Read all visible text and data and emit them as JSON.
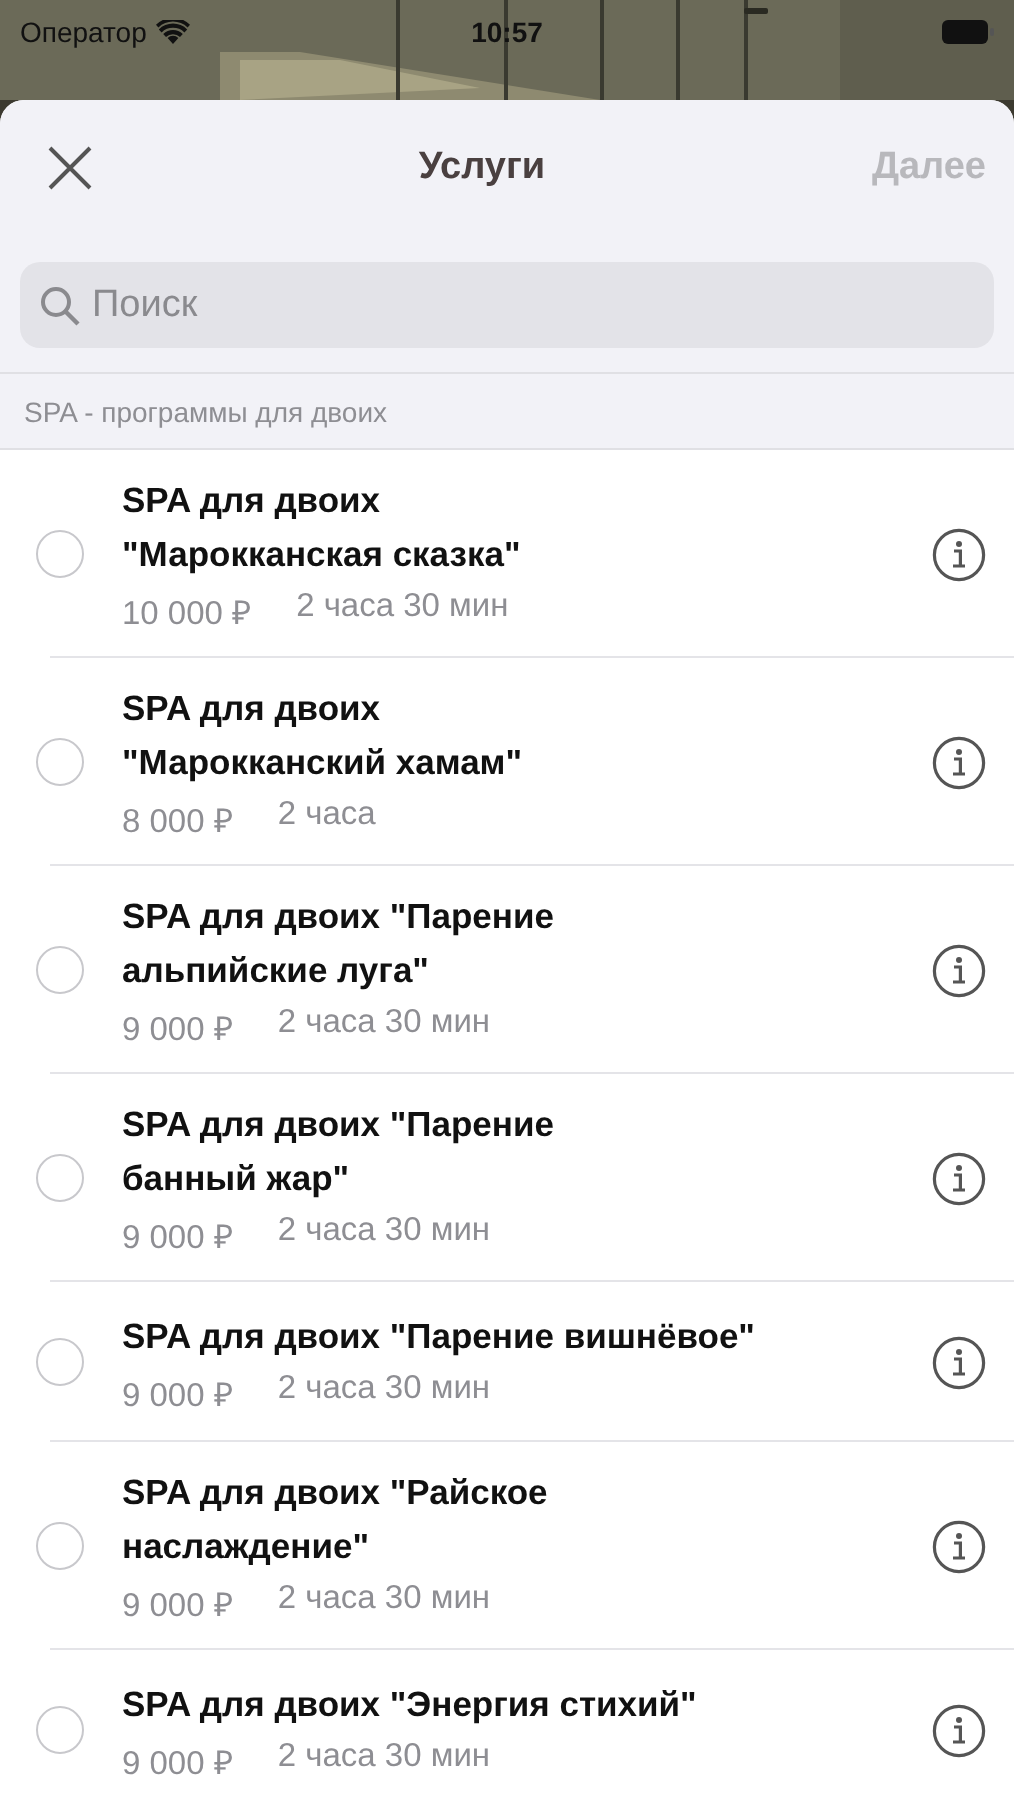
{
  "status_bar": {
    "carrier": "Оператор",
    "time": "10:57"
  },
  "nav": {
    "title": "Услуги",
    "next": {
      "label": "Далее",
      "disabled": true
    }
  },
  "search": {
    "placeholder": "Поиск"
  },
  "section": {
    "title": "SPA - программы для двоих"
  },
  "services": [
    {
      "title": "SPA для двоих\n\"Марокканская сказка\"",
      "price": "10 000 ₽",
      "duration": "2 часа 30 мин",
      "selected": false
    },
    {
      "title": "SPA для двоих\n\"Марокканский хамам\"",
      "price": "8 000 ₽",
      "duration": "2 часа",
      "selected": false
    },
    {
      "title": "SPA для двоих \"Парение\nальпийские луга\"",
      "price": "9 000 ₽",
      "duration": "2 часа 30 мин",
      "selected": false
    },
    {
      "title": "SPA для двоих \"Парение\nбанный жар\"",
      "price": "9 000 ₽",
      "duration": "2 часа 30 мин",
      "selected": false
    },
    {
      "title": "SPA для двоих \"Парение вишнёвое\"",
      "price": "9 000 ₽",
      "duration": "2 часа 30 мин",
      "selected": false
    },
    {
      "title": "SPA для двоих \"Райское\nнаслаждение\"",
      "price": "9 000 ₽",
      "duration": "2 часа 30 мин",
      "selected": false
    },
    {
      "title": "SPA для двоих \"Энергия стихий\"",
      "price": "9 000 ₽",
      "duration": "2 часа 30 мин",
      "selected": false
    }
  ]
}
